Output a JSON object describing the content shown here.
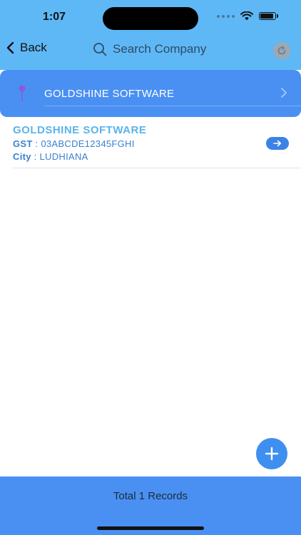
{
  "status_bar": {
    "time": "1:07"
  },
  "nav": {
    "back_label": "Back",
    "search_placeholder": "Search Company",
    "icons": {
      "back": "chevron-left-icon",
      "search": "magnifier-icon",
      "refresh": "refresh-icon"
    }
  },
  "selected_company": {
    "name": "GOLDSHINE SOFTWARE",
    "icons": {
      "pin": "map-pin-icon",
      "chevron": "chevron-right-icon"
    }
  },
  "companies": [
    {
      "title": "GOLDSHINE SOFTWARE",
      "gst_label": "GST",
      "gst_value": "03ABCDE12345FGHI",
      "city_label": "City",
      "city_value": "LUDHIANA"
    }
  ],
  "separator": " : ",
  "footer": {
    "total_text": "Total 1 Records"
  },
  "colors": {
    "header_bg": "#5fb8f6",
    "accent_blue": "#4a90f2",
    "title_blue": "#5bb3ea",
    "detail_blue": "#3b7fd0",
    "button_blue": "#3b82e6"
  }
}
